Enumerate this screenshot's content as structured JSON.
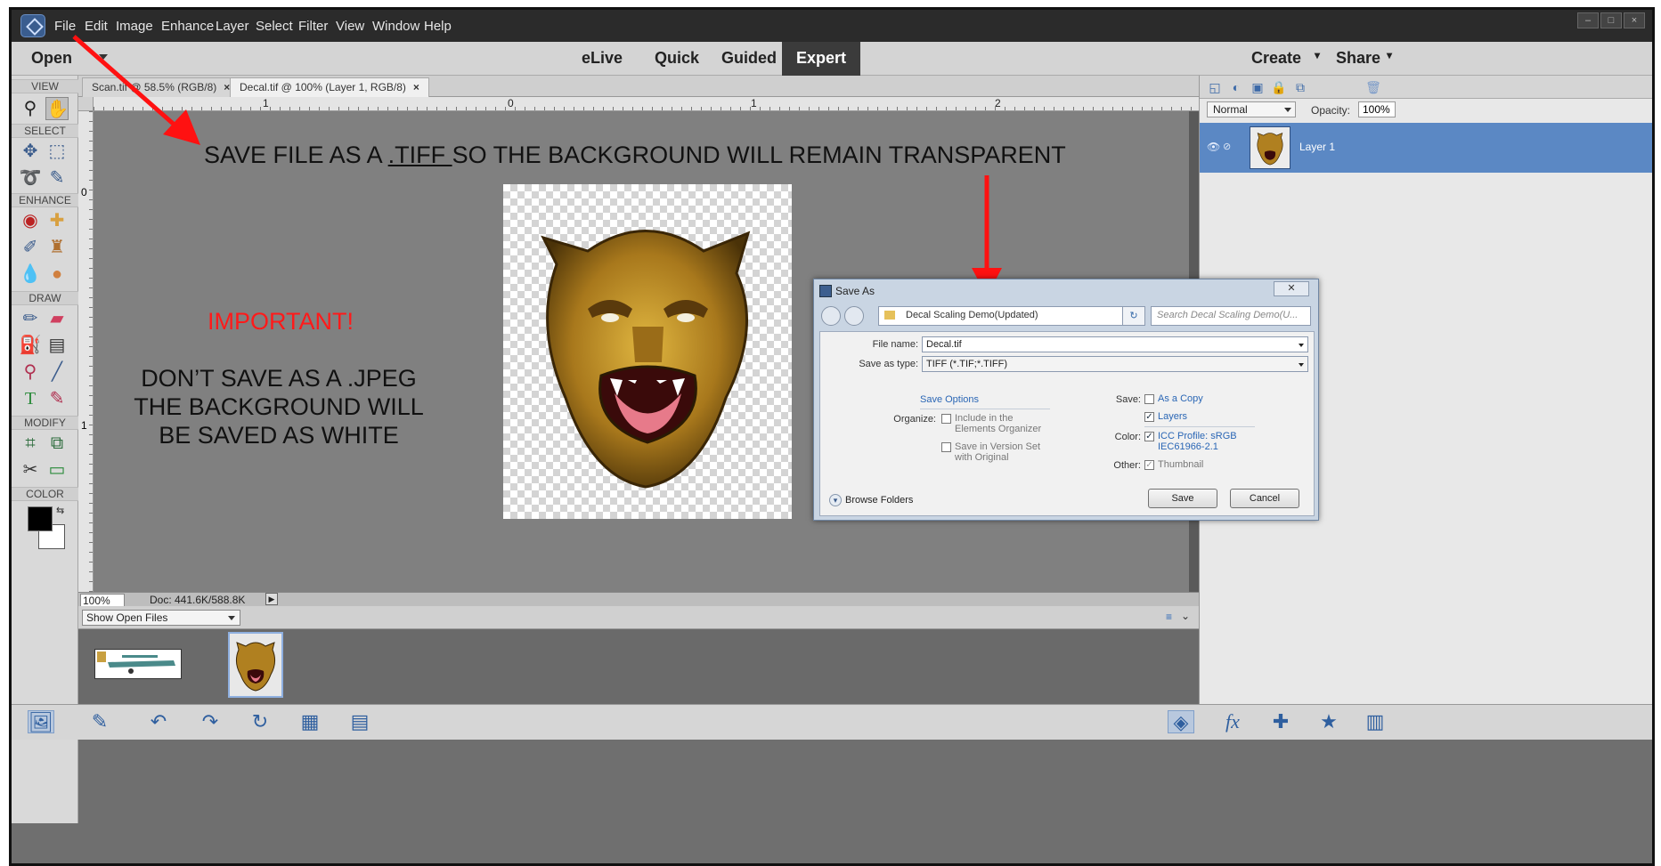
{
  "menu": {
    "items": [
      "File",
      "Edit",
      "Image",
      "Enhance",
      "Layer",
      "Select",
      "Filter",
      "View",
      "Window",
      "Help"
    ]
  },
  "modebar": {
    "open_label": "Open",
    "modes": [
      "eLive",
      "Quick",
      "Guided",
      "Expert"
    ],
    "active_mode": "Expert",
    "create_label": "Create",
    "share_label": "Share"
  },
  "doc_tabs": [
    {
      "label": "Scan.tif @ 58.5% (RGB/8)"
    },
    {
      "label": "Decal.tif @ 100% (Layer 1, RGB/8)"
    }
  ],
  "toolbox": {
    "sections": [
      "VIEW",
      "SELECT",
      "ENHANCE",
      "DRAW",
      "MODIFY",
      "COLOR"
    ]
  },
  "rulers": {
    "h_ticks": [
      "1",
      "0",
      "1",
      "2"
    ],
    "v_ticks": [
      "0",
      "1"
    ]
  },
  "status": {
    "zoom": "100%",
    "doc": "Doc: 441.6K/588.8K"
  },
  "bin": {
    "select_label": "Show Open Files"
  },
  "layers": {
    "blend_mode": "Normal",
    "opacity_label": "Opacity:",
    "opacity_value": "100%",
    "layer_name": "Layer 1"
  },
  "annotations": {
    "headline_pre": "SAVE FILE AS A ",
    "headline_ext": ".TIFF ",
    "headline_post": "SO THE BACKGROUND WILL REMAIN TRANSPARENT",
    "important": "IMPORTANT!",
    "warn_line1": "DON’T SAVE AS A .JPEG",
    "warn_line2": "THE BACKGROUND WILL",
    "warn_line3": "BE SAVED AS WHITE",
    "arrow_color": "#ff1111"
  },
  "dialog": {
    "title": "Save As",
    "path": "Decal Scaling Demo(Updated)",
    "search_placeholder": "Search Decal Scaling Demo(U...",
    "file_name_label": "File name:",
    "file_name": "Decal.tif",
    "save_type_label": "Save as type:",
    "save_type": "TIFF (*.TIF;*.TIFF)",
    "save_options": "Save Options",
    "organize_label": "Organize:",
    "include_organizer": "Include in the Elements Organizer",
    "version_set": "Save in Version Set with Original",
    "save_label": "Save:",
    "as_copy": "As a Copy",
    "layers": "Layers",
    "color_label": "Color:",
    "icc_profile": "ICC Profile: sRGB IEC61966-2.1",
    "other_label": "Other:",
    "thumbnail": "Thumbnail",
    "browse_folders": "Browse Folders",
    "save_button": "Save",
    "cancel_button": "Cancel"
  }
}
